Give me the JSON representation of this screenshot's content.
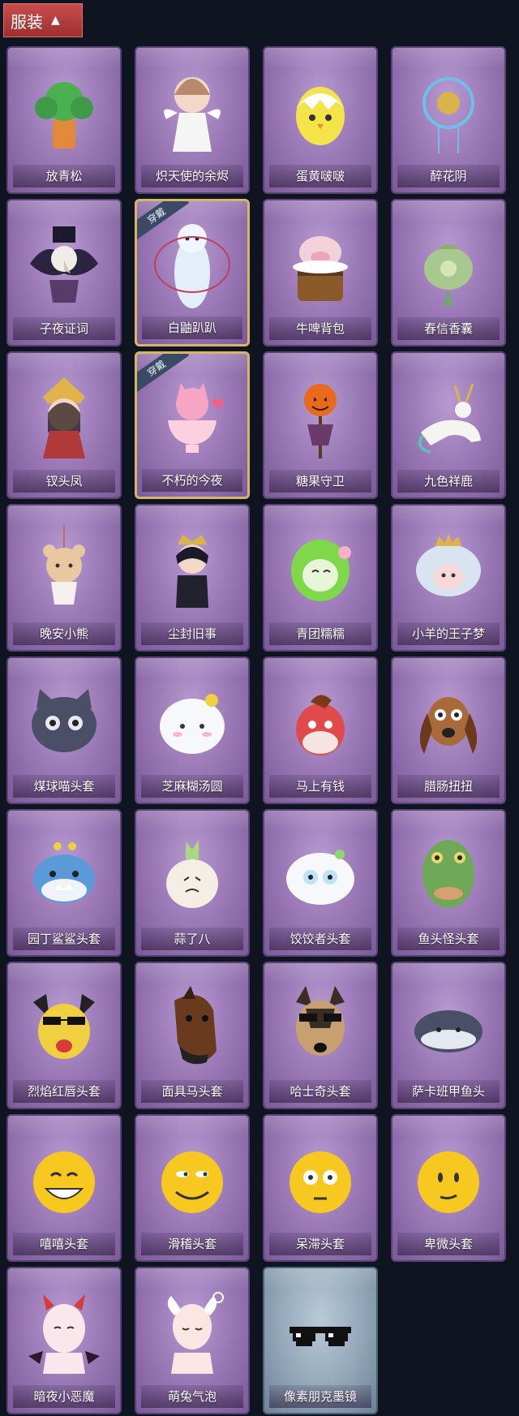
{
  "header": {
    "title": "服装"
  },
  "badge_text": "穿戴",
  "items": [
    {
      "label": "放青松",
      "icon": "pine-bonsai-icon"
    },
    {
      "label": "炽天使的余烬",
      "icon": "angel-doll-icon"
    },
    {
      "label": "蛋黄啵啵",
      "icon": "egg-chick-icon"
    },
    {
      "label": "醉花阴",
      "icon": "flower-lantern-icon"
    },
    {
      "label": "子夜证词",
      "icon": "crow-mask-icon"
    },
    {
      "label": "白鼬趴趴",
      "icon": "white-ferret-icon",
      "equipped": true
    },
    {
      "label": "牛啤背包",
      "icon": "cow-barrel-icon"
    },
    {
      "label": "春信香囊",
      "icon": "sachet-icon"
    },
    {
      "label": "钗头凤",
      "icon": "phoenix-crown-doll-icon"
    },
    {
      "label": "不朽的今夜",
      "icon": "pink-fox-bowl-icon",
      "equipped": true
    },
    {
      "label": "糖果守卫",
      "icon": "pumpkin-scarecrow-icon"
    },
    {
      "label": "九色祥鹿",
      "icon": "deer-charm-icon"
    },
    {
      "label": "晚安小熊",
      "icon": "bear-charm-icon"
    },
    {
      "label": "尘封旧事",
      "icon": "prince-doll-icon"
    },
    {
      "label": "青团糯糯",
      "icon": "green-dumpling-icon"
    },
    {
      "label": "小羊的王子梦",
      "icon": "sheep-crown-icon"
    },
    {
      "label": "煤球喵头套",
      "icon": "black-cat-head-icon"
    },
    {
      "label": "芝麻糊汤圆",
      "icon": "rice-ball-head-icon"
    },
    {
      "label": "马上有钱",
      "icon": "red-horse-head-icon"
    },
    {
      "label": "腊肠扭扭",
      "icon": "sausage-dog-head-icon"
    },
    {
      "label": "园丁鲨鲨头套",
      "icon": "shark-head-icon"
    },
    {
      "label": "蒜了八",
      "icon": "garlic-head-icon"
    },
    {
      "label": "饺饺者头套",
      "icon": "dumpling-head-icon"
    },
    {
      "label": "鱼头怪头套",
      "icon": "fish-head-icon"
    },
    {
      "label": "烈焰红唇头套",
      "icon": "yellow-mouse-head-icon"
    },
    {
      "label": "面具马头套",
      "icon": "horse-mask-icon"
    },
    {
      "label": "哈士奇头套",
      "icon": "husky-head-icon"
    },
    {
      "label": "萨卡班甲鱼头",
      "icon": "armored-fish-head-icon"
    },
    {
      "label": "嘻嘻头套",
      "icon": "grin-emoji-head-icon"
    },
    {
      "label": "滑稽头套",
      "icon": "smirk-emoji-head-icon"
    },
    {
      "label": "呆滞头套",
      "icon": "blank-emoji-head-icon"
    },
    {
      "label": "卑微头套",
      "icon": "humble-emoji-head-icon"
    },
    {
      "label": "暗夜小恶魔",
      "icon": "devil-head-icon"
    },
    {
      "label": "萌兔气泡",
      "icon": "bunny-bubble-icon"
    },
    {
      "label": "像素朋克墨镜",
      "icon": "pixel-sunglasses-icon",
      "blue": true
    }
  ]
}
